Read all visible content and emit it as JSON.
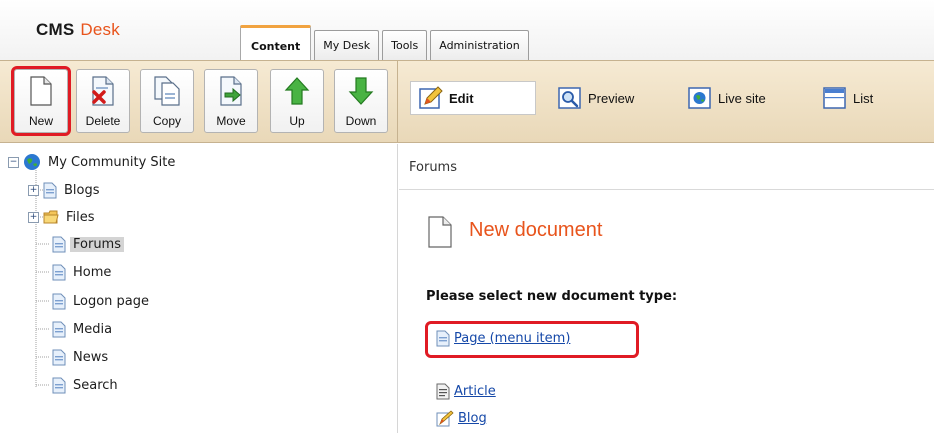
{
  "app": {
    "logo_primary": "CMS",
    "logo_secondary": "Desk"
  },
  "tabs": [
    {
      "label": "Content",
      "active": true
    },
    {
      "label": "My Desk",
      "active": false
    },
    {
      "label": "Tools",
      "active": false
    },
    {
      "label": "Administration",
      "active": false
    }
  ],
  "toolbar": {
    "new": "New",
    "delete": "Delete",
    "copy": "Copy",
    "move": "Move",
    "up": "Up",
    "down": "Down"
  },
  "view_modes": {
    "edit": "Edit",
    "preview": "Preview",
    "live_site": "Live site",
    "list": "List"
  },
  "tree": {
    "root": "My Community Site",
    "items": [
      "Blogs",
      "Files",
      "Forums",
      "Home",
      "Logon page",
      "Media",
      "News",
      "Search"
    ],
    "selected": "Forums"
  },
  "content": {
    "breadcrumb": "Forums",
    "title": "New document",
    "prompt": "Please select new document type:",
    "document_types": [
      "Page (menu item)",
      "Article",
      "Blog"
    ]
  },
  "colors": {
    "accent_orange": "#e8541c",
    "toolbar_bg": "#f0e2c6",
    "highlight_red": "#e01b24",
    "link_blue": "#1548a8"
  }
}
